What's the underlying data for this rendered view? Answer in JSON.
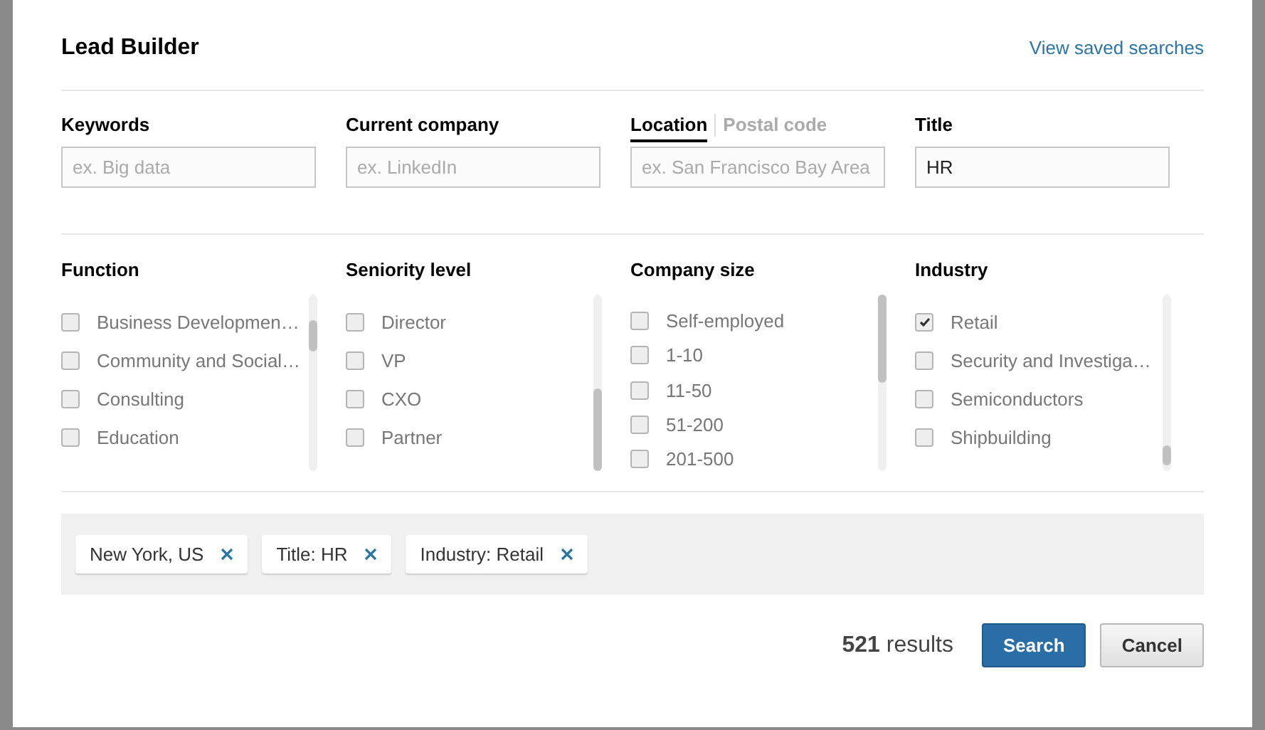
{
  "dialog": {
    "title": "Lead Builder",
    "saved_searches_link": "View saved searches"
  },
  "fields": [
    {
      "kind": "label",
      "label": "Keywords",
      "placeholder": "ex. Big data"
    },
    {
      "kind": "label",
      "label": "Current company",
      "placeholder": "ex. LinkedIn"
    },
    {
      "kind": "tabs",
      "tabs": [
        {
          "label": "Location",
          "selected": true
        },
        {
          "label": "Postal code",
          "selected": false
        }
      ],
      "placeholder": "ex. San Francisco Bay Area"
    },
    {
      "kind": "label",
      "label": "Title",
      "value": "HR"
    }
  ],
  "facets": [
    {
      "title": "Function",
      "options": [
        {
          "label": "Business Developmen…",
          "checked": false
        },
        {
          "label": "Community and Social…",
          "checked": false
        },
        {
          "label": "Consulting",
          "checked": false
        },
        {
          "label": "Education",
          "checked": false
        }
      ]
    },
    {
      "title": "Seniority level",
      "options": [
        {
          "label": "Director",
          "checked": false
        },
        {
          "label": "VP",
          "checked": false
        },
        {
          "label": "CXO",
          "checked": false
        },
        {
          "label": "Partner",
          "checked": false
        }
      ]
    },
    {
      "title": "Company size",
      "options": [
        {
          "label": "Self-employed",
          "checked": false
        },
        {
          "label": "1-10",
          "checked": false
        },
        {
          "label": "11-50",
          "checked": false
        },
        {
          "label": "51-200",
          "checked": false
        },
        {
          "label": "201-500",
          "checked": false
        }
      ]
    },
    {
      "title": "Industry",
      "options": [
        {
          "label": "Retail",
          "checked": true
        },
        {
          "label": "Security and Investiga…",
          "checked": false
        },
        {
          "label": "Semiconductors",
          "checked": false
        },
        {
          "label": "Shipbuilding",
          "checked": false
        }
      ]
    }
  ],
  "filters": [
    "New York, US",
    "Title: HR",
    "Industry: Retail"
  ],
  "results": {
    "count": "521",
    "label": "results"
  },
  "buttons": [
    {
      "kind": "primary",
      "label": "Search"
    },
    {
      "kind": "secondary",
      "label": "Cancel"
    }
  ]
}
